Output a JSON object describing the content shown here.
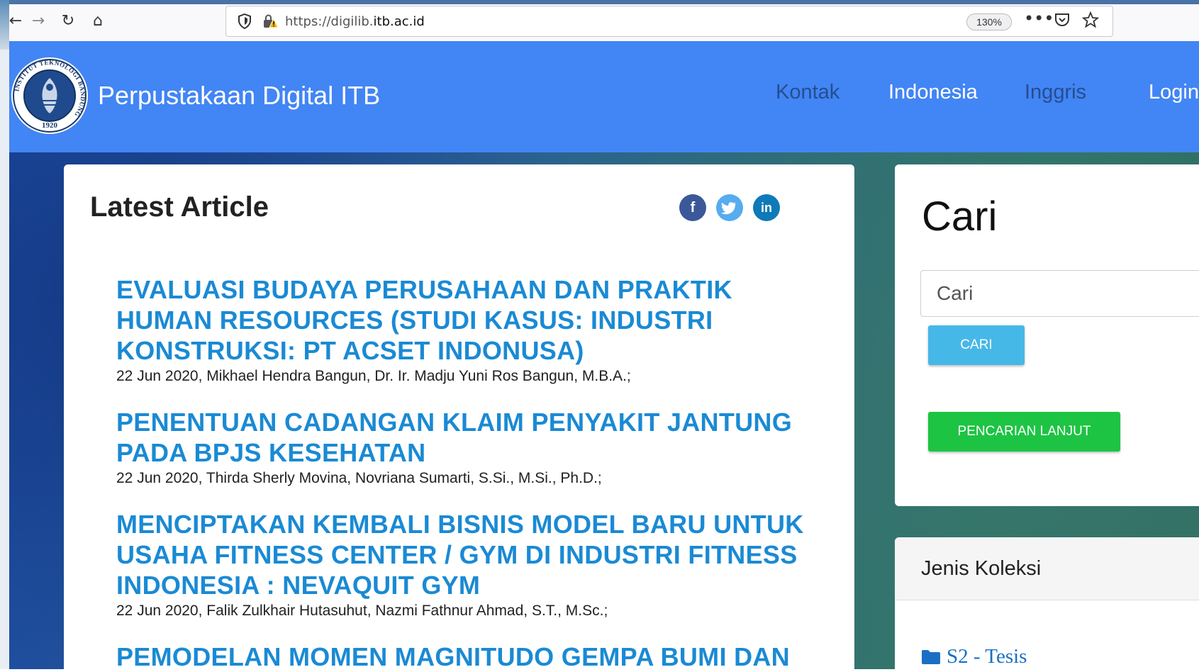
{
  "browser": {
    "url_prefix": "https://digilib.",
    "url_domain": "itb.ac.id",
    "zoom": "130%"
  },
  "header": {
    "site_title": "Perpustakaan Digital ITB",
    "nav": [
      "Kontak",
      "Indonesia",
      "Inggris",
      "Login"
    ],
    "logo_text_top": "INSTITUT TEKNOLOGI BANDUNG",
    "logo_year": "1920"
  },
  "main": {
    "title": "Latest Article",
    "articles": [
      {
        "title": "EVALUASI BUDAYA PERUSAHAAN DAN PRAKTIK HUMAN RESOURCES (STUDI KASUS: INDUSTRI KONSTRUKSI: PT ACSET INDONUSA)",
        "meta": "22 Jun 2020, Mikhael Hendra Bangun, Dr. Ir. Madju Yuni Ros Bangun, M.B.A.;"
      },
      {
        "title": "PENENTUAN CADANGAN KLAIM PENYAKIT JANTUNG PADA BPJS KESEHATAN",
        "meta": "22 Jun 2020, Thirda Sherly Movina, Novriana Sumarti, S.Si., M.Si., Ph.D.;"
      },
      {
        "title": "MENCIPTAKAN KEMBALI BISNIS MODEL BARU UNTUK USAHA FITNESS CENTER / GYM DI INDUSTRI FITNESS INDONESIA : NEVAQUIT GYM",
        "meta": "22 Jun 2020, Falik Zulkhair Hutasuhut, Nazmi Fathnur Ahmad, S.T., M.Sc.;"
      },
      {
        "title": "PEMODELAN MOMEN MAGNITUDO GEMPA BUMI DAN",
        "meta": ""
      }
    ]
  },
  "search": {
    "title": "Cari",
    "placeholder": "Cari",
    "button": "CARI",
    "advanced_button": "PENCARIAN LANJUT"
  },
  "collection": {
    "title": "Jenis Koleksi",
    "item": "S2 - Tesis"
  },
  "colors": {
    "header_blue": "#4285f4",
    "link_blue": "#1a8ad4",
    "search_button": "#46b8e8",
    "advanced_button": "#1dc443"
  },
  "icons": [
    "back-icon",
    "forward-icon",
    "reload-icon",
    "home-icon",
    "shield-icon",
    "lock-icon",
    "more-icon",
    "pocket-icon",
    "bookmark-star-icon",
    "facebook-icon",
    "twitter-icon",
    "linkedin-icon",
    "folder-icon"
  ]
}
